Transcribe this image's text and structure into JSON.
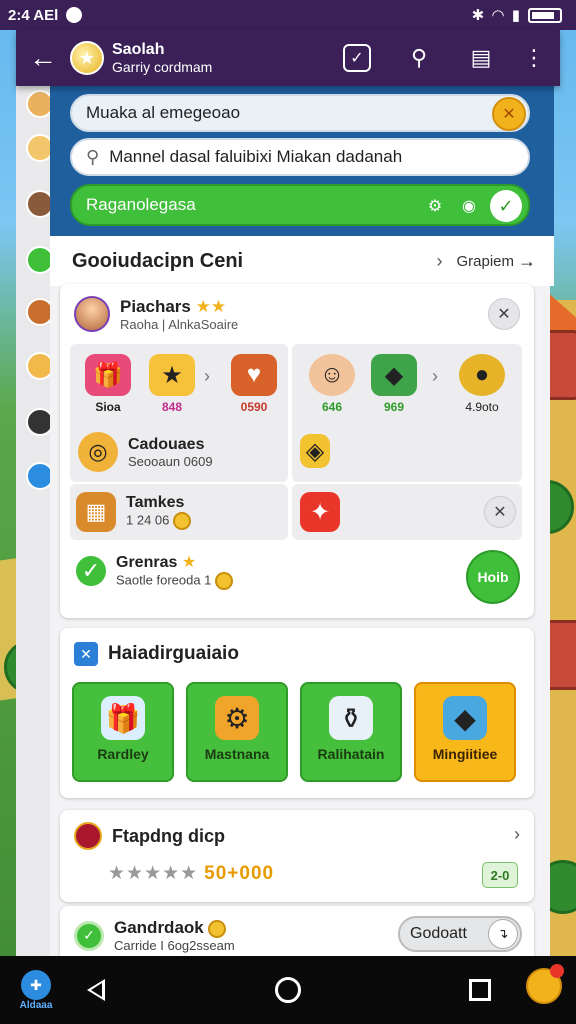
{
  "status_bar": {
    "time": "2:4 AEl",
    "icons": [
      "notification-icon",
      "bluetooth-icon",
      "wifi-icon",
      "signal-icon",
      "battery-icon"
    ]
  },
  "app_bar": {
    "title": "Saolah",
    "subtitle": "Garriy cordmam",
    "actions": [
      "task-check-icon",
      "search-icon",
      "document-icon",
      "more-vert-icon"
    ]
  },
  "fields": {
    "top_input_value": "Muaka al emegeoao",
    "search_value": "Mannel dasal faluibixi Miakan dadanah",
    "green_bar_label": "Raganolegasa"
  },
  "section": {
    "title": "Gooiudacipn Ceni",
    "link": "Grapiem"
  },
  "group_card": {
    "title": "Piachars",
    "subtitle": "Raoha | AlnkaSoaire",
    "left_items": [
      {
        "icon": "gift-box-icon",
        "value": "Sioa"
      },
      {
        "icon": "gold-box-icon",
        "value": "848"
      },
      {
        "icon": "heart-card-icon",
        "value": "0590"
      }
    ],
    "right_items": [
      {
        "icon": "avatar-icon",
        "value": "646"
      },
      {
        "icon": "treasure-icon",
        "value": "969"
      },
      {
        "icon": "gold-bar-icon",
        "value": "4.9oto"
      }
    ],
    "row_currency": {
      "title": "Cadouaes",
      "subtitle": "Seooaun 0609"
    },
    "row_tasks": {
      "title": "Tamkes",
      "subtitle": "1 24 06"
    },
    "row_greeting": {
      "title": "Grenras",
      "subtitle": "Saotle foreoda 1",
      "button": "Hoib"
    }
  },
  "management": {
    "title": "Haiadirguaiaio",
    "tiles": [
      {
        "label": "Rardley",
        "icon": "gift-icon"
      },
      {
        "label": "Mastnana",
        "icon": "gear-icon"
      },
      {
        "label": "Ralihatain",
        "icon": "bottle-icon"
      },
      {
        "label": "Mingiitiee",
        "icon": "gem-box-icon"
      }
    ]
  },
  "rating": {
    "title": "Ftapdng dicp",
    "stars": "★★★★★",
    "score": "50+000",
    "badge": "2-0"
  },
  "last_card": {
    "title": "Gandrdaok",
    "subtitle": "Carride I 6og2sseam",
    "toggle_label": "Godoatt"
  },
  "nav_bar": {
    "left_label": "Aldaaa"
  },
  "colors": {
    "purple_bar": "#3b1f57",
    "green": "#3fbf3a",
    "gold": "#f8b81a",
    "blue": "#1f5f9e"
  }
}
